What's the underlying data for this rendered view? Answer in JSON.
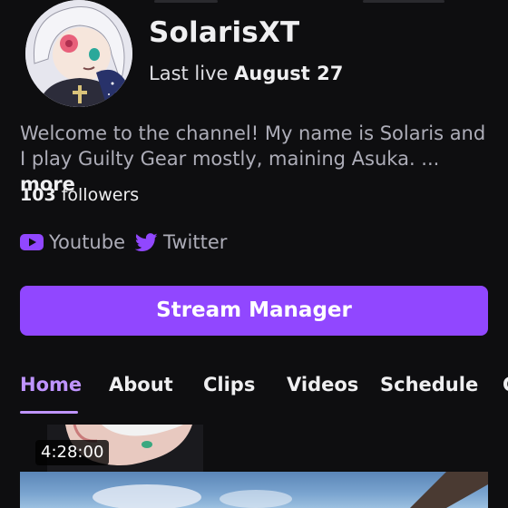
{
  "channel": {
    "name": "SolarisXT",
    "last_live_prefix": "Last live",
    "last_live_date": "August 27",
    "bio": "Welcome to the channel! My name is Solaris and I play Guilty Gear mostly, maining Asuka. ...",
    "bio_more": "more",
    "followers_count": "103",
    "followers_label": "followers"
  },
  "social": [
    {
      "label": "Youtube",
      "icon": "youtube-icon",
      "color": "#9147ff"
    },
    {
      "label": "Twitter",
      "icon": "twitter-icon",
      "color": "#9147ff"
    }
  ],
  "stream_manager_label": "Stream Manager",
  "tabs": [
    {
      "label": "Home",
      "active": true
    },
    {
      "label": "About",
      "active": false
    },
    {
      "label": "Clips",
      "active": false
    },
    {
      "label": "Videos",
      "active": false
    },
    {
      "label": "Schedule",
      "active": false
    },
    {
      "label": "C",
      "active": false
    }
  ],
  "video": {
    "duration": "4:28:00"
  },
  "colors": {
    "accent": "#9147ff",
    "active_tab": "#bf94ff",
    "background": "#0e0e10"
  }
}
